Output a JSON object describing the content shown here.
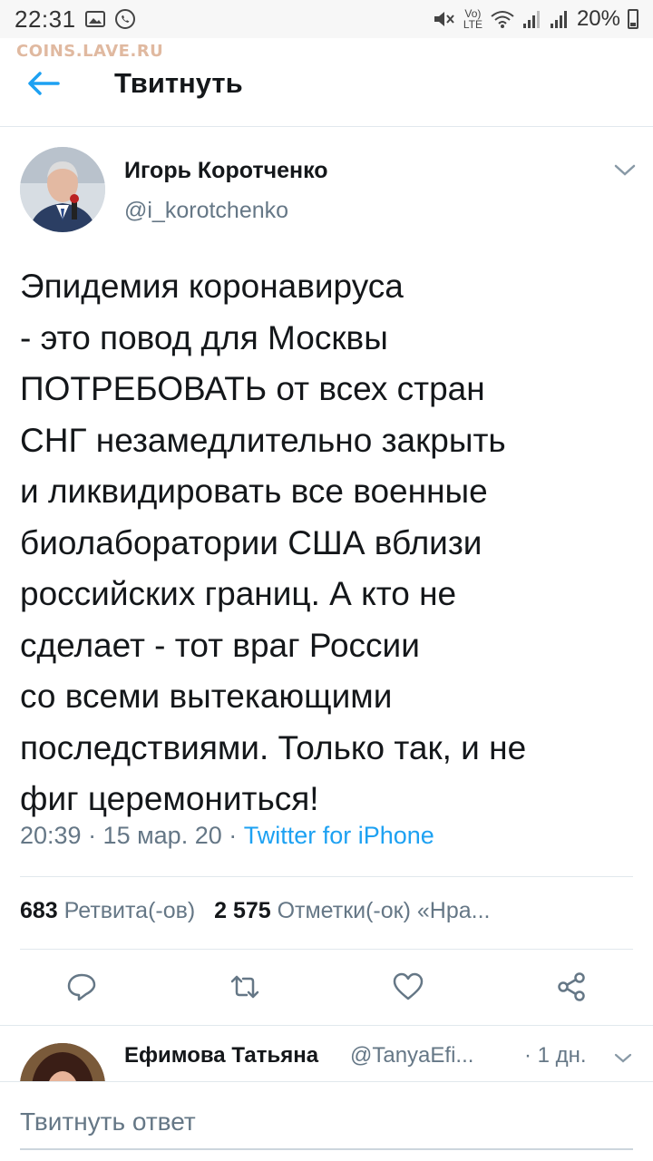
{
  "status_bar": {
    "time": "22:31",
    "battery": "20%",
    "network": "LTE"
  },
  "watermark": "COINS.LAVE.RU",
  "app_bar": {
    "title": "Твитнуть"
  },
  "tweet": {
    "author_name": "Игорь Коротченко",
    "author_handle": "@i_korotchenko",
    "text": "Эпидемия коронавируса\n- это повод для Москвы\nПОТРЕБОВАТЬ от всех стран\nСНГ незамедлительно закрыть\nи ликвидировать все военные\nбиолаборатории США вблизи\nроссийских границ. А кто не\nсделает - тот враг России\nсо всеми вытекающими\nпоследствиями. Только так, и не\nфиг церемониться!",
    "timestamp": "20:39 · 15 мар. 20 · ",
    "source": "Twitter for iPhone",
    "retweets_count": "683",
    "retweets_label": " Ретвита(-ов)",
    "likes_count": "2 575",
    "likes_label": " Отметки(-ок) «Нра..."
  },
  "reply": {
    "author_name": "Ефимова Татьяна",
    "author_handle": "@TanyaEfi...",
    "time": "· 1 дн."
  },
  "composer": {
    "placeholder": "Твитнуть ответ"
  },
  "colors": {
    "accent": "#1da1f2",
    "secondary_text": "#657786",
    "divider": "#e1e8ed"
  }
}
